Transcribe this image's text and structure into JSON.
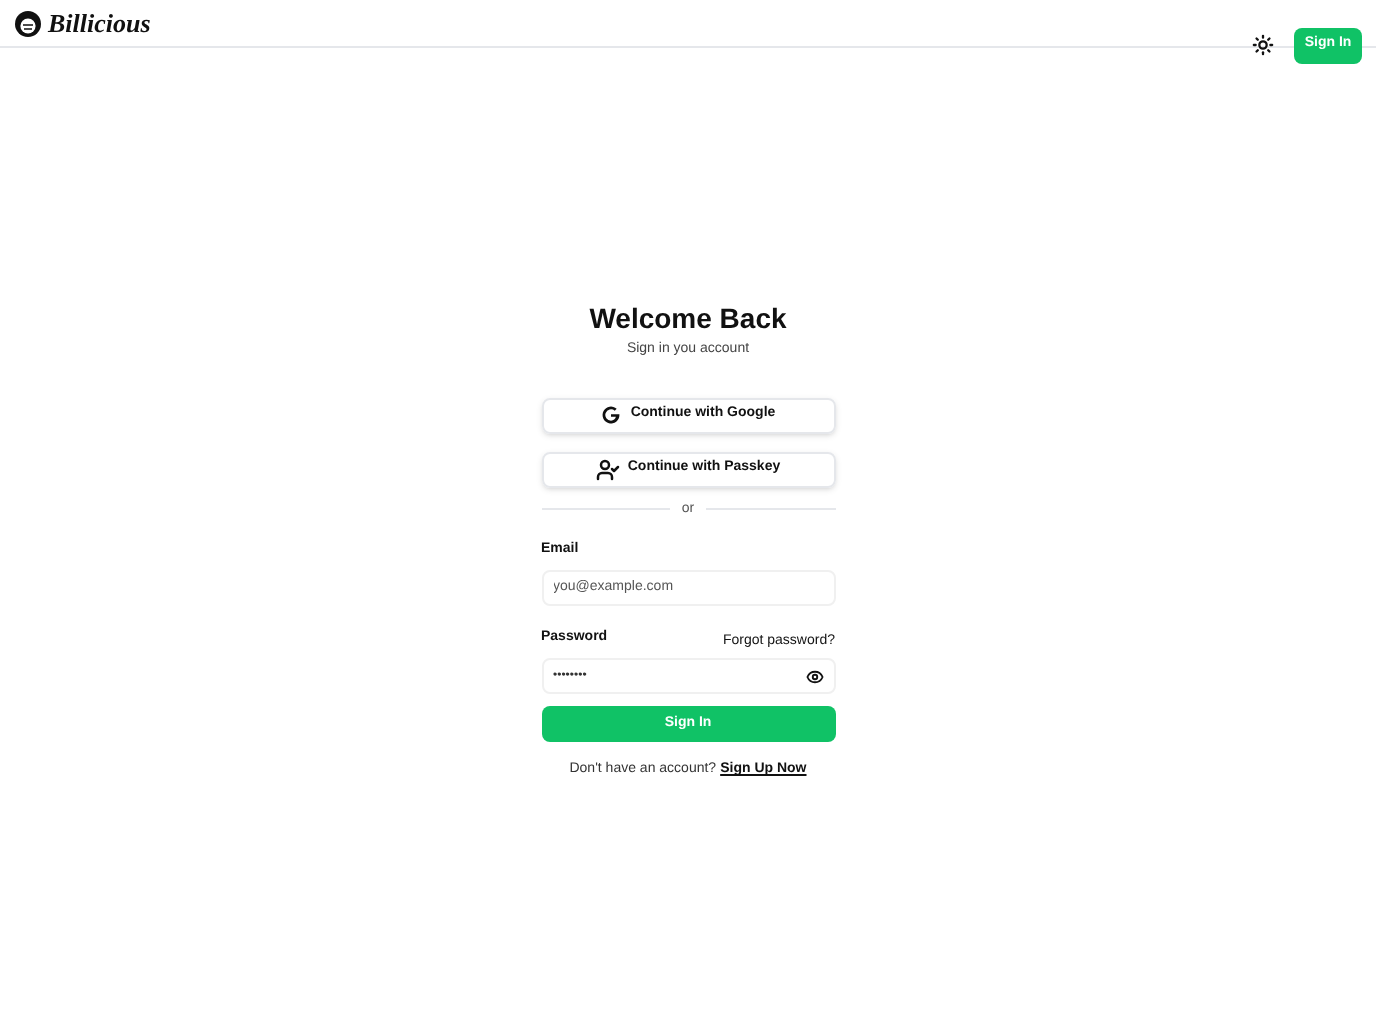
{
  "header": {
    "brand": "Billicious",
    "sign_in_button": "Sign In"
  },
  "form": {
    "title": "Welcome Back",
    "subtitle": "Sign in you account",
    "providers": [
      {
        "kind": "google",
        "label": "Continue with Google"
      },
      {
        "kind": "passkey",
        "label": "Continue with Passkey"
      }
    ],
    "divider": "or",
    "email": {
      "label": "Email",
      "placeholder": "you@example.com"
    },
    "password": {
      "label": "Password",
      "forgot_link": "Forgot password?",
      "value": "••••••••"
    },
    "submit": "Sign In",
    "footer": {
      "text": "Don't have an account?",
      "link": "Sign Up Now"
    }
  }
}
